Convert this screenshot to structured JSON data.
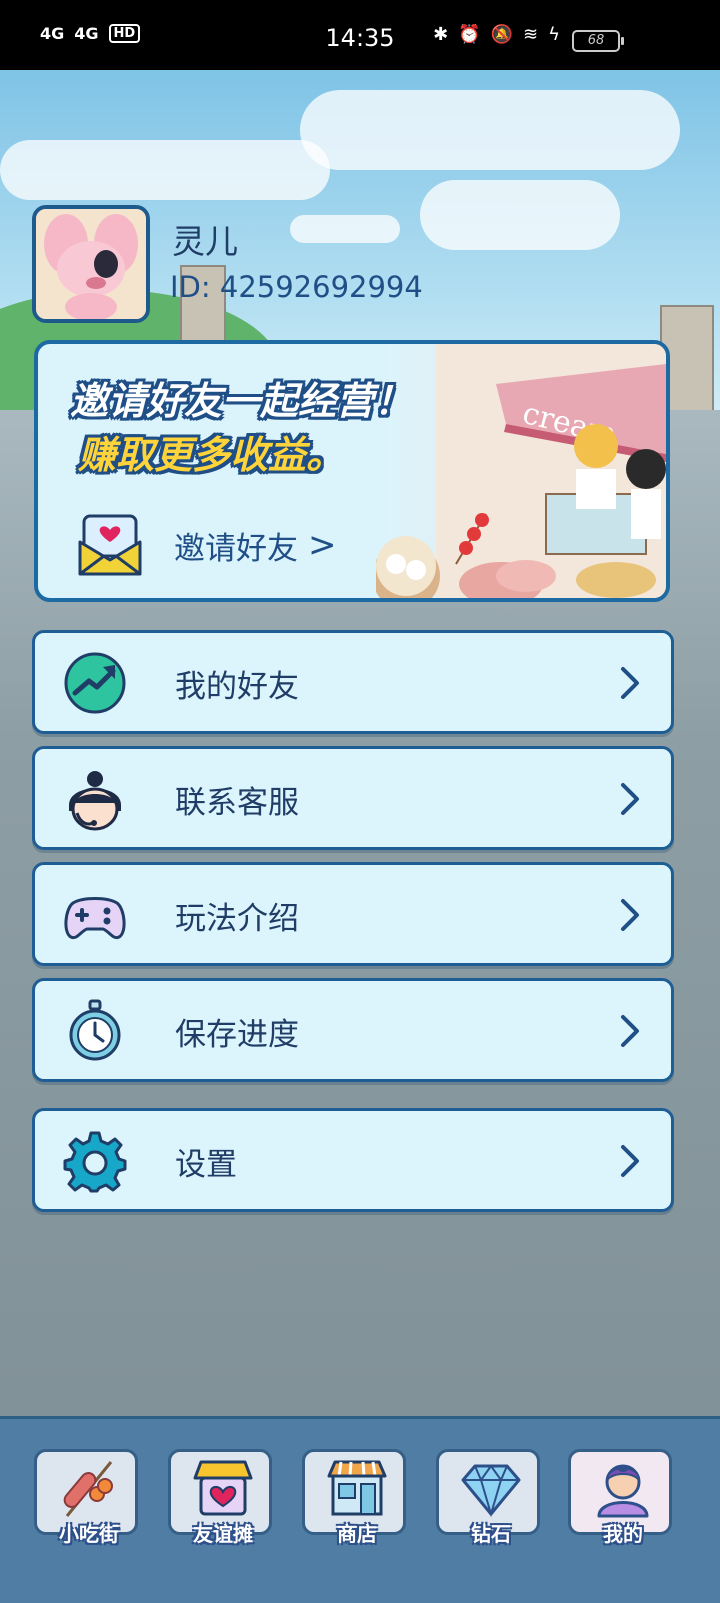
{
  "status_bar": {
    "signal_1": "4G",
    "signal_2": "4G",
    "hd": "HD",
    "time": "14:35",
    "battery": "68"
  },
  "profile": {
    "name": "灵儿",
    "id": "ID: 42592692994"
  },
  "invite": {
    "line1": "邀请好友一起经营！",
    "line2": "赚取更多收益。",
    "button_label": "邀请好友",
    "chevron": ">"
  },
  "menu": [
    {
      "label": "我的好友",
      "icon": "trend-chart-icon"
    },
    {
      "label": "联系客服",
      "icon": "customer-service-icon"
    },
    {
      "label": "玩法介绍",
      "icon": "gamepad-icon"
    },
    {
      "label": "保存进度",
      "icon": "stopwatch-icon"
    },
    {
      "label": "设置",
      "icon": "gear-icon"
    }
  ],
  "bottom_nav": [
    {
      "label": "小吃街",
      "icon": "sausage-skewer-icon"
    },
    {
      "label": "友谊摊",
      "icon": "friendship-stall-icon"
    },
    {
      "label": "商店",
      "icon": "shop-icon"
    },
    {
      "label": "钻石",
      "icon": "diamond-icon"
    },
    {
      "label": "我的",
      "icon": "profile-person-icon",
      "active": true
    }
  ],
  "colors": {
    "accent_blue": "#1f5d95",
    "row_bg": "#dcf4fc",
    "nav_bg": "#4f7da4",
    "highlight_yellow": "#ffd33a"
  }
}
